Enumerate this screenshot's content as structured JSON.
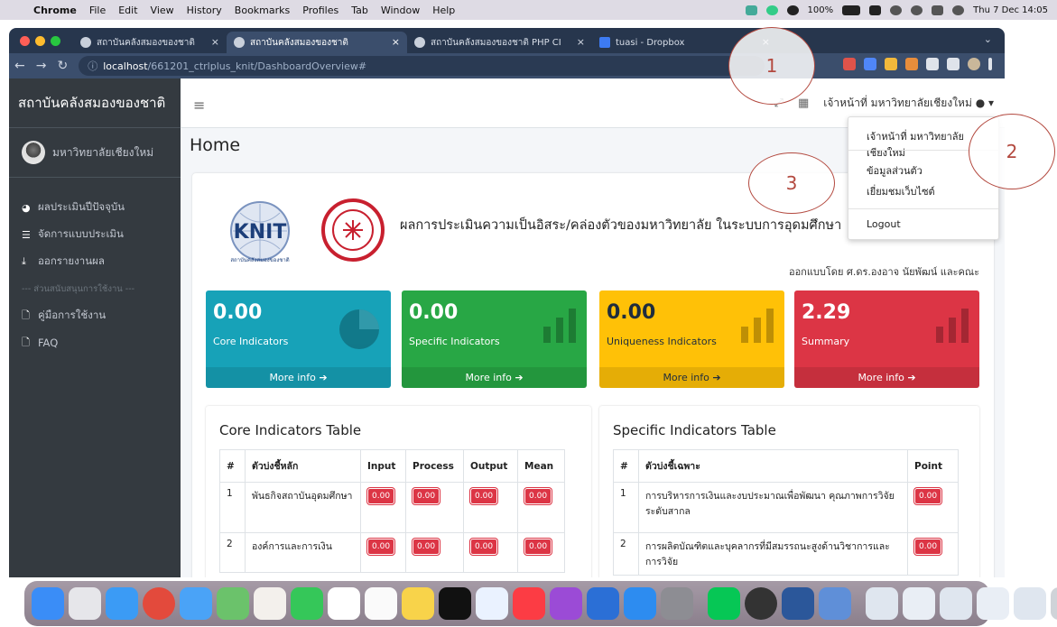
{
  "macbar": {
    "app": "Chrome",
    "menus": [
      "File",
      "Edit",
      "View",
      "History",
      "Bookmarks",
      "Profiles",
      "Tab",
      "Window",
      "Help"
    ],
    "battery": "100%",
    "clock": "Thu 7 Dec  14:05"
  },
  "browser": {
    "tabs": [
      {
        "title": "สถาบันคลังสมองของชาติ"
      },
      {
        "title": "สถาบันคลังสมองของชาติ"
      },
      {
        "title": "สถาบันคลังสมองของชาติ PHP CI"
      },
      {
        "title": "tuasi - Dropbox"
      }
    ],
    "url_host": "localhost",
    "url_path": "/661201_ctrlplus_knit/DashboardOverview#"
  },
  "sidebar": {
    "brand": "สถาบันคลังสมองของชาติ",
    "user": "มหาวิทยาลัยเชียงใหม่",
    "items": [
      {
        "label": "ผลประเมินปีปัจจุบัน",
        "icon": "chart-pie-icon"
      },
      {
        "label": "จัดการแบบประเมิน",
        "icon": "list-icon"
      },
      {
        "label": "ออกรายงานผล",
        "icon": "download-icon"
      }
    ],
    "section_header": "--- ส่วนสนับสนุนการใช้งาน ---",
    "support": [
      {
        "label": "คู่มือการใช้งาน",
        "icon": "file-icon"
      },
      {
        "label": "FAQ",
        "icon": "file-icon"
      }
    ]
  },
  "topnav": {
    "account_label": "เจ้าหน้าที่ มหาวิทยาลัยเชียงใหม่"
  },
  "dropdown": {
    "header": "เจ้าหน้าที่ มหาวิทยาลัยเชียงใหม่",
    "profile": "ข้อมูลส่วนตัว",
    "visit_site": "เยี่ยมชมเว็บไซต์",
    "logout": "Logout"
  },
  "page": {
    "title": "Home",
    "heading": "ผลการประเมินความเป็นอิสระ/คล่องตัวของมหาวิทยาลัย ในระบบการอุดมศึกษา",
    "designed_by": "ออกแบบโดย ศ.ดร.องอาจ นัยพัฒน์ และคณะ",
    "logo_text": "KNIT",
    "logo_sub": "สถาบันคลังสมองของชาติ"
  },
  "boxes": [
    {
      "value": "0.00",
      "label": "Core Indicators",
      "more": "More info",
      "color": "#17a2b8"
    },
    {
      "value": "0.00",
      "label": "Specific Indicators",
      "more": "More info",
      "color": "#28a745"
    },
    {
      "value": "0.00",
      "label": "Uniqueness Indicators",
      "more": "More info",
      "color": "#ffc107"
    },
    {
      "value": "2.29",
      "label": "Summary",
      "more": "More info",
      "color": "#dc3545"
    }
  ],
  "core_table": {
    "title": "Core Indicators Table",
    "headers": [
      "#",
      "ตัวบ่งชี้หลัก",
      "Input",
      "Process",
      "Output",
      "Mean"
    ],
    "rows": [
      {
        "no": "1",
        "name": "พันธกิจสถาบันอุดมศึกษา",
        "input": "0.00",
        "process": "0.00",
        "output": "0.00",
        "mean": "0.00"
      },
      {
        "no": "2",
        "name": "องค์การและการเงิน",
        "input": "0.00",
        "process": "0.00",
        "output": "0.00",
        "mean": "0.00"
      }
    ]
  },
  "specific_table": {
    "title": "Specific Indicators Table",
    "headers": [
      "#",
      "ตัวบ่งชี้เฉพาะ",
      "Point"
    ],
    "rows": [
      {
        "no": "1",
        "name": "การบริหารการเงินและงบประมาณเพื่อพัฒนา คุณภาพการวิจัยระดับสากล",
        "point": "0.00"
      },
      {
        "no": "2",
        "name": "การผลิตบัณฑิตและบุคลากรที่มีสมรรถนะสูงด้านวิชาการและการวิจัย",
        "point": "0.00"
      }
    ]
  },
  "callouts": [
    "1",
    "2",
    "3"
  ]
}
